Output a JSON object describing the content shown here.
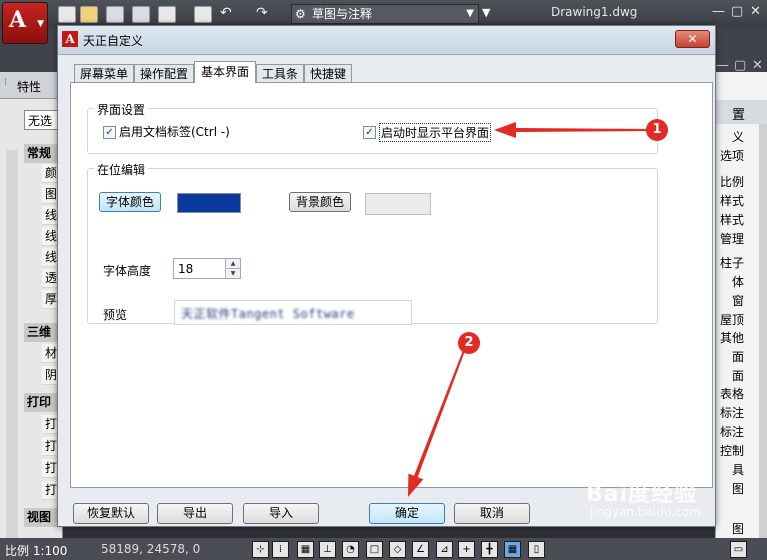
{
  "app": {
    "logo_letter": "A",
    "workspace": "草图与注释",
    "doc_title": "Drawing1.dwg",
    "window_controls": [
      "—",
      "▢",
      "✕"
    ]
  },
  "properties_panel": {
    "title": "特性",
    "selection": "无选",
    "categories": [
      {
        "label": "常规",
        "rows": [
          "颜",
          "图",
          "线",
          "线",
          "线",
          "透",
          "厚"
        ]
      },
      {
        "label": "三维",
        "rows": [
          "材",
          "阴"
        ]
      },
      {
        "label": "打印",
        "rows": [
          "打",
          "打",
          "打",
          "打"
        ]
      },
      {
        "label": "视图",
        "rows": []
      }
    ]
  },
  "right_panel": {
    "header": "置",
    "items": [
      "义",
      "选项",
      "比例",
      "样式",
      "样式",
      "管理",
      "柱子",
      "体",
      "窗",
      "屋顶",
      "其他",
      "面",
      "面",
      "表格",
      "标注",
      "标注",
      "控制",
      "具",
      "图",
      "图"
    ]
  },
  "statusbar": {
    "scale": "比例 1:100",
    "coords": "58189, 24578, 0"
  },
  "dialog": {
    "title": "天正自定义",
    "close_label": "✕",
    "tabs": [
      {
        "label": "屏幕菜单",
        "active": false
      },
      {
        "label": "操作配置",
        "active": false
      },
      {
        "label": "基本界面",
        "active": true
      },
      {
        "label": "工具条",
        "active": false
      },
      {
        "label": "快捷键",
        "active": false
      }
    ],
    "interface_group": {
      "legend": "界面设置",
      "doc_tabs": {
        "label": "启用文档标签(Ctrl -)",
        "checked": true
      },
      "startup_platform": {
        "label": "启动时显示平台界面",
        "checked": true
      }
    },
    "inplace_group": {
      "legend": "在位编辑",
      "font_color_button": "字体颜色",
      "font_color": "#0a3a9e",
      "bg_color_button": "背景颜色",
      "bg_color": "#ebebeb",
      "font_height_label": "字体高度",
      "font_height_value": "18",
      "preview_label": "预览",
      "preview_text": "天正软件Tangent Software"
    },
    "bottom_buttons": {
      "restore": "恢复默认",
      "export": "导出",
      "import": "导入",
      "ok": "确定",
      "cancel": "取消"
    }
  },
  "annotations": {
    "marker_1": "1",
    "marker_2": "2",
    "arrow_color": "#e12b25"
  },
  "watermark": {
    "brand": "Bai度经验",
    "url": "jingyan.baidu.com"
  }
}
